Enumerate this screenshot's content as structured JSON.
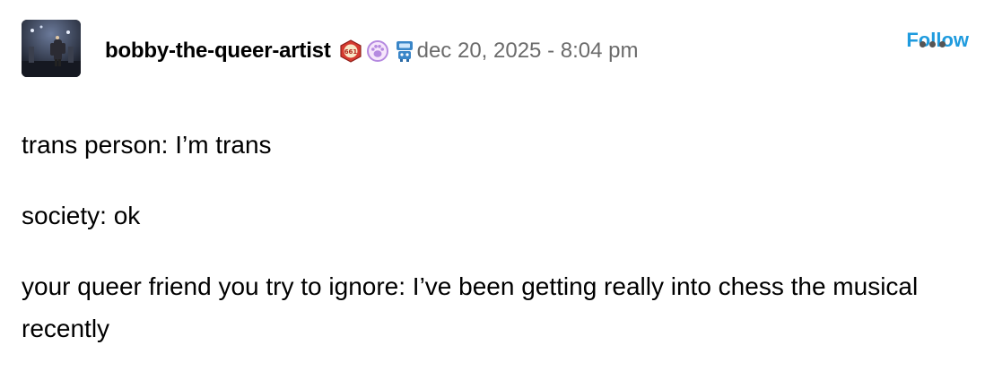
{
  "post": {
    "username": "bobby-the-queer-artist",
    "badges": [
      "hexagon-badge-icon",
      "paw-badge-icon",
      "robot-badge-icon"
    ],
    "hexagon_badge_text": "661",
    "timestamp": "dec 20, 2025 - 8:04 pm",
    "follow_label": "Follow",
    "lines": [
      "trans person: I’m trans",
      "society: ok",
      "your queer friend you try to ignore: I’ve been getting really into chess the musical recently"
    ]
  },
  "colors": {
    "follow": "#1f9bde",
    "timestamp": "#6b6b6b",
    "hexagon_badge": "#d63a2f",
    "paw_badge": "#b58ae0",
    "robot_badge": "#3a86c8"
  }
}
